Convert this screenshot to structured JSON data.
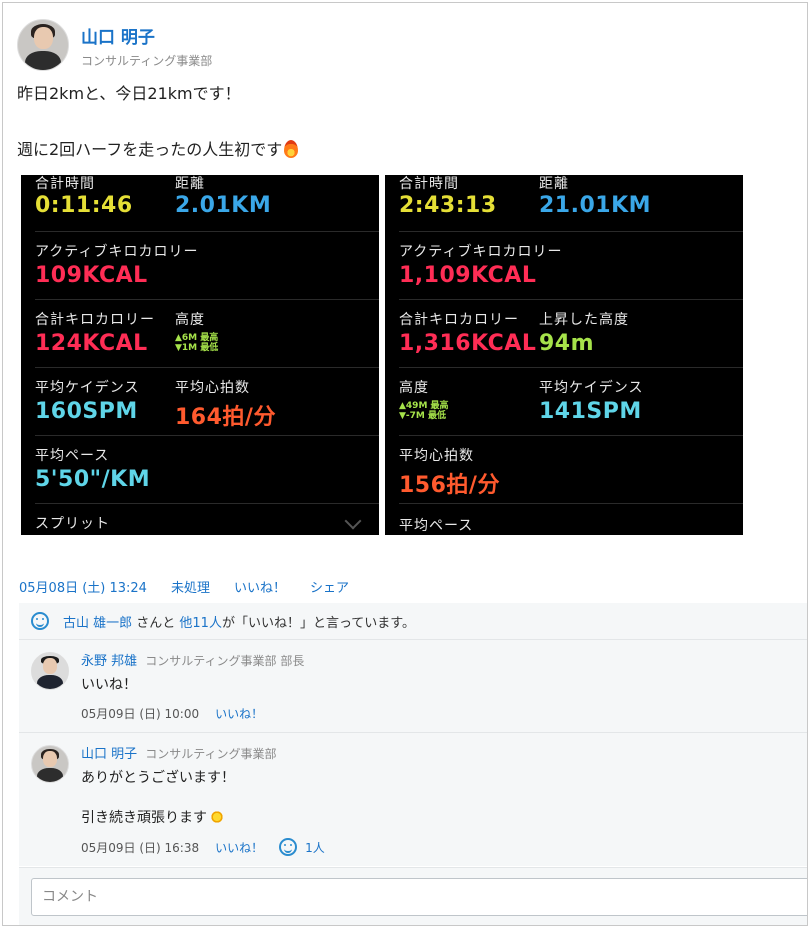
{
  "post": {
    "author_name": "山口 明子",
    "author_dept": "コンサルティング事業部",
    "lines": [
      "昨日2kmと、今日21kmです！",
      "",
      "週に2回ハーフを走ったの人生初です"
    ],
    "emoji": "fire-icon"
  },
  "workouts": [
    {
      "total_time_label": "合計時間",
      "total_time": "0:11:46",
      "distance_label": "距離",
      "distance": "2.01KM",
      "active_kcal_label": "アクティブキロカロリー",
      "active_kcal": "109KCAL",
      "total_kcal_label": "合計キロカロリー",
      "total_kcal": "124KCAL",
      "elev_label": "高度",
      "elev_high": "▲6M 最高",
      "elev_low": "▼1M 最低",
      "cadence_label": "平均ケイデンス",
      "cadence": "160SPM",
      "hr_label": "平均心拍数",
      "hr": "164拍/分",
      "pace_label": "平均ペース",
      "pace": "5'50\"/KM",
      "split_label": "スプリット"
    },
    {
      "total_time_label": "合計時間",
      "total_time": "2:43:13",
      "distance_label": "距離",
      "distance": "21.01KM",
      "active_kcal_label": "アクティブキロカロリー",
      "active_kcal": "1,109KCAL",
      "total_kcal_label": "合計キロカロリー",
      "total_kcal": "1,316KCAL",
      "gain_label": "上昇した高度",
      "gain": "94m",
      "elev_label": "高度",
      "elev_high": "▲49M 最高",
      "elev_low": "▼-7M 最低",
      "cadence_label": "平均ケイデンス",
      "cadence": "141SPM",
      "hr_label": "平均心拍数",
      "hr": "156拍/分",
      "pace_label": "平均ペース"
    }
  ],
  "meta": {
    "date": "05月08日 (土) 13:24",
    "status": "未処理",
    "like": "いいね！",
    "share": "シェア"
  },
  "likes": {
    "user": "古山 雄一郎",
    "mid": " さんと ",
    "others": "他11人",
    "tail": "が「いいね！」と言っています。"
  },
  "comments": [
    {
      "name": "永野 邦雄",
      "dept": "コンサルティング事業部 部長",
      "lines": [
        "いいね！"
      ],
      "date": "05月09日 (日) 10:00",
      "like": "いいね！"
    },
    {
      "name": "山口 明子",
      "dept": "コンサルティング事業部",
      "lines": [
        "ありがとうございます！",
        "",
        "引き続き頑張ります"
      ],
      "date": "05月09日 (日) 16:38",
      "like": "いいね！",
      "like_count": "1人"
    }
  ],
  "comment_box": {
    "placeholder": "コメント"
  }
}
